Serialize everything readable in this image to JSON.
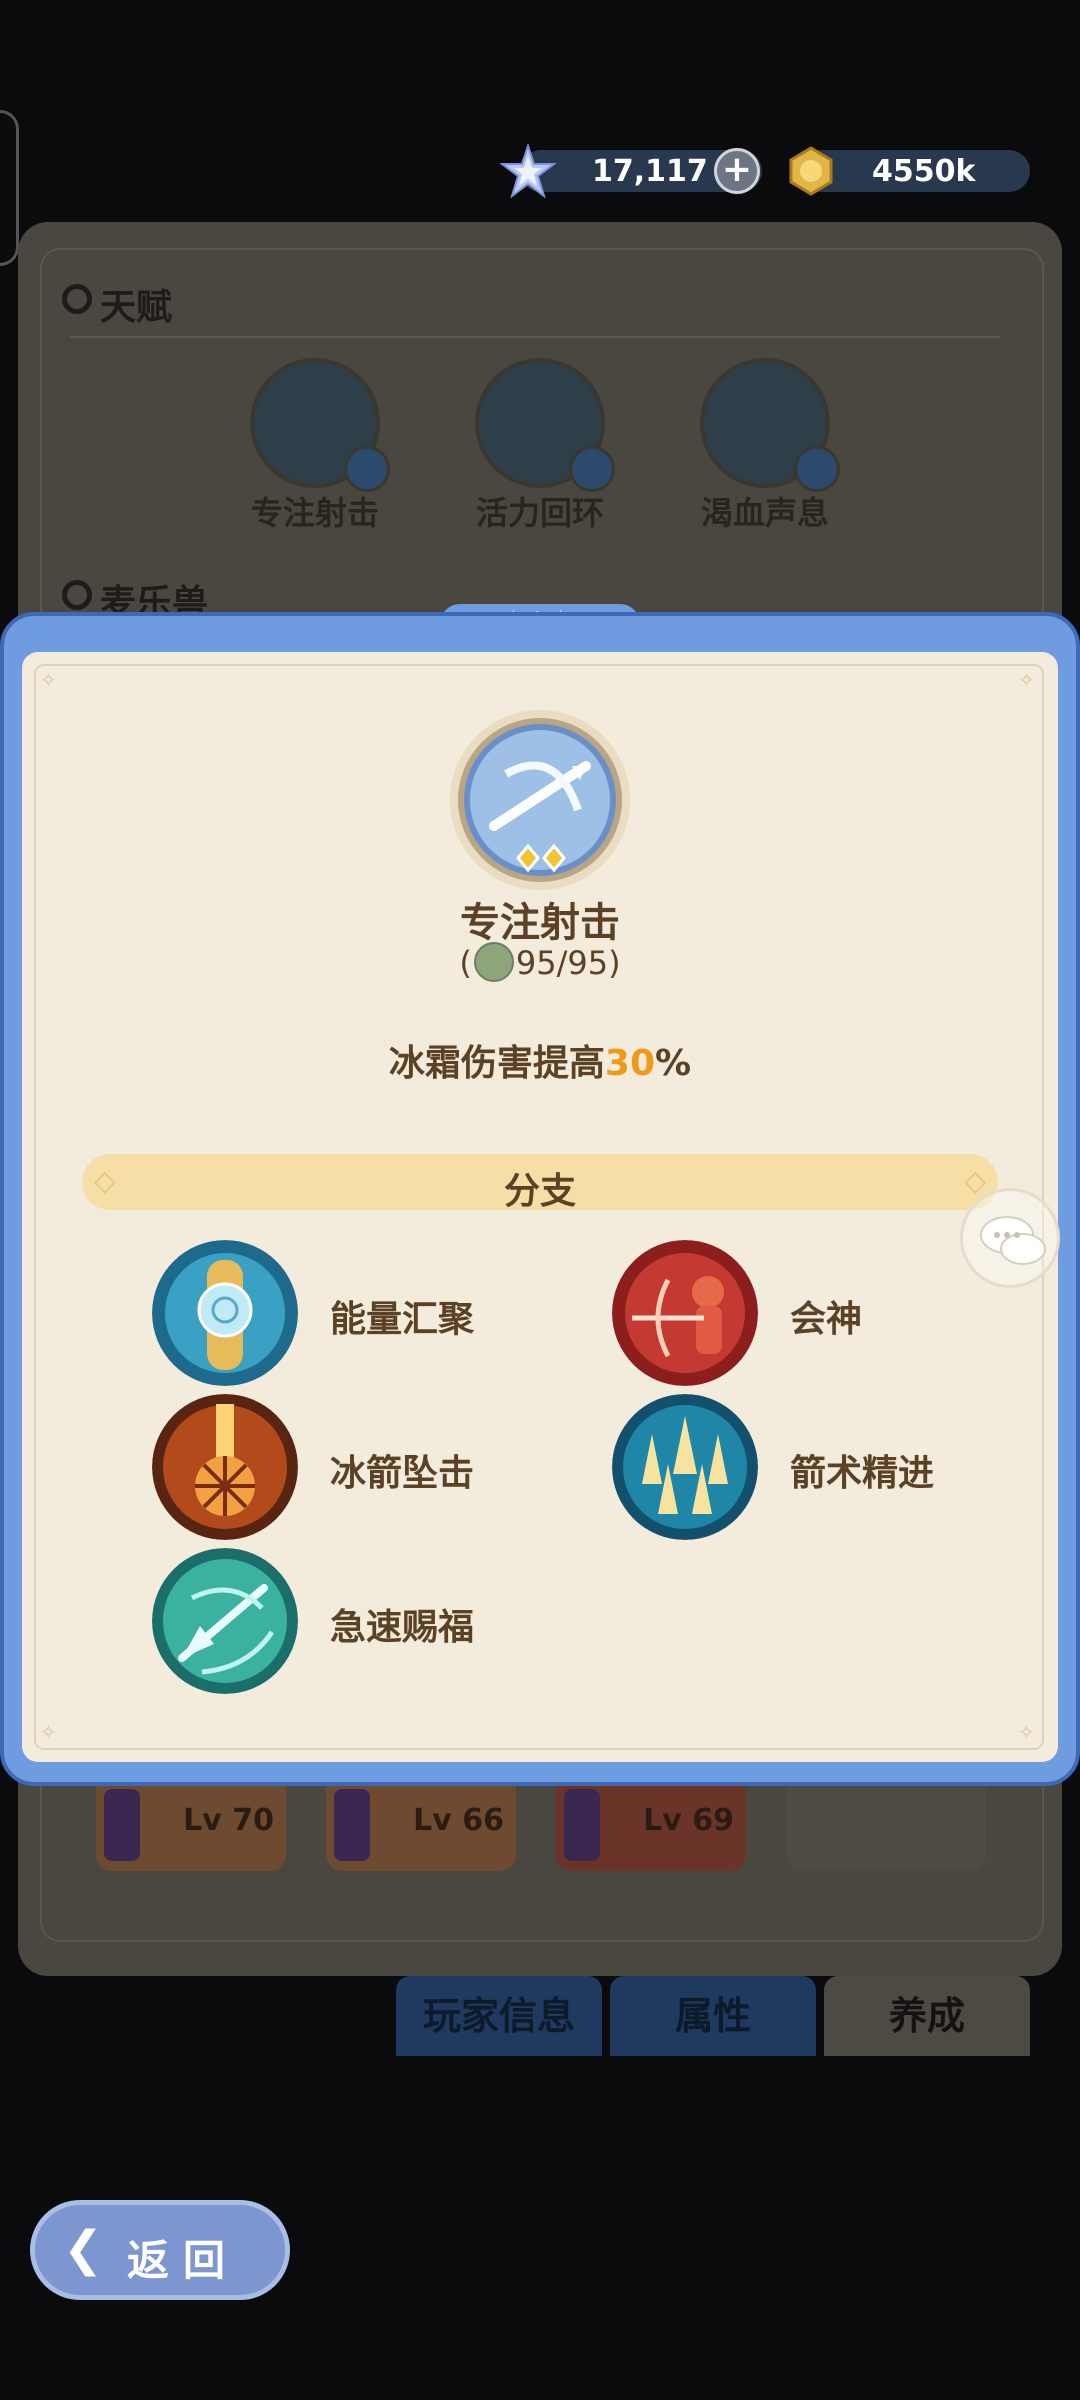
{
  "currency": {
    "gems": "17,117",
    "gold": "4550k"
  },
  "background": {
    "talent_section_title": "天赋",
    "talents": [
      "专注射击",
      "活力回环",
      "渴血声息"
    ],
    "pet_section_title": "麦乐兽",
    "pets": [
      {
        "level": "Lv 70"
      },
      {
        "level": "Lv 66"
      },
      {
        "level": "Lv 69"
      }
    ],
    "tabs": [
      "玩家信息",
      "属性",
      "养成"
    ],
    "back_label": "返回"
  },
  "popup": {
    "skill_name": "专注射击",
    "progress_open": "(",
    "progress": "95/95",
    "progress_close": ")",
    "desc_prefix": "冰霜伤害提高",
    "desc_value": "30",
    "desc_suffix": "%",
    "branch_title": "分支",
    "branches": [
      {
        "label": "能量汇聚",
        "icon": "energy-gather-icon"
      },
      {
        "label": "会神",
        "icon": "focus-archer-icon"
      },
      {
        "label": "冰箭坠击",
        "icon": "ice-arrow-strike-icon"
      },
      {
        "label": "箭术精进",
        "icon": "archery-mastery-icon"
      },
      {
        "label": "急速赐福",
        "icon": "swift-blessing-icon"
      }
    ]
  },
  "colors": {
    "popup_frame": "#6f9be0",
    "popup_body": "#f3ebdc",
    "text_brown": "#5b4226",
    "highlight_orange": "#f09a1a",
    "branch_bar": "#f6dfa7"
  }
}
